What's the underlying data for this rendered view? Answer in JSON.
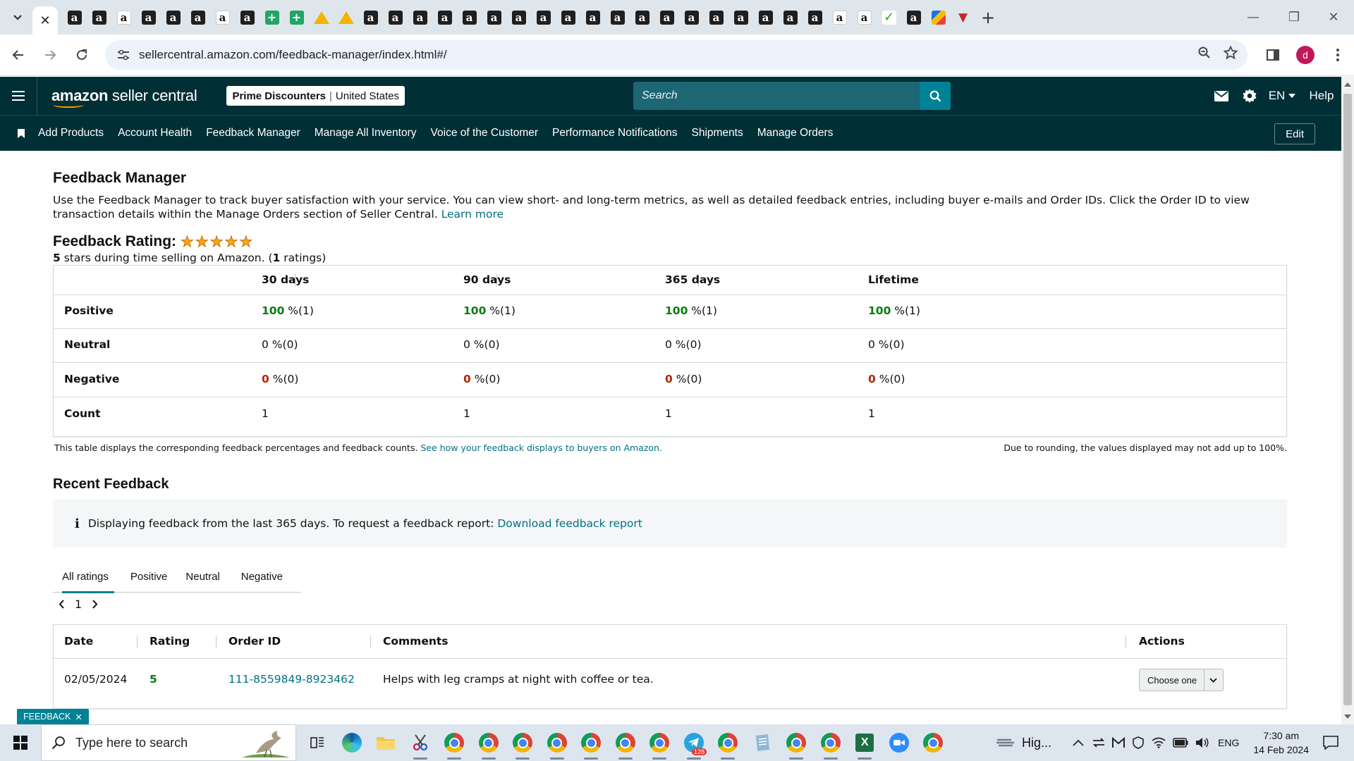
{
  "browser": {
    "url": "sellercentral.amazon.com/feedback-manager/index.html#/",
    "tab_favicons": [
      "amazon",
      "amazon",
      "amazon-white",
      "amazon",
      "amazon",
      "amazon",
      "amazon-white",
      "amazon",
      "sheets",
      "sheets",
      "drive",
      "drive",
      "amazon",
      "amazon",
      "amazon",
      "amazon",
      "amazon",
      "amazon",
      "amazon",
      "amazon",
      "amazon",
      "amazon",
      "amazon",
      "amazon",
      "amazon",
      "amazon",
      "amazon",
      "amazon",
      "amazon",
      "amazon",
      "amazon",
      "amazon-white",
      "amazon-white",
      "green-logo",
      "amazon",
      "pencil",
      "red-logo"
    ]
  },
  "header": {
    "logo_text_bold": "amazon",
    "logo_text": "seller central",
    "store_name": "Prime Discounters",
    "store_region": "United States",
    "search_placeholder": "Search",
    "language": "EN",
    "help": "Help"
  },
  "nav": {
    "links": [
      "Add Products",
      "Account Health",
      "Feedback Manager",
      "Manage All Inventory",
      "Voice of the Customer",
      "Performance Notifications",
      "Shipments",
      "Manage Orders"
    ],
    "edit_label": "Edit"
  },
  "page": {
    "title": "Feedback Manager",
    "intro": "Use the Feedback Manager to track buyer satisfaction with your service. You can view short- and long-term metrics, as well as detailed feedback entries, including buyer e-mails and Order IDs. Click the Order ID to view transaction details within the Manage Orders section of Seller Central.",
    "learn_more": "Learn more",
    "rating_label": "Feedback Rating:",
    "rating_stars": 5,
    "rating_value": "5",
    "rating_sub_mid": " stars during time selling on Amazon. (",
    "rating_count": "1",
    "rating_sub_end": " ratings)"
  },
  "metrics": {
    "columns": [
      "30 days",
      "90 days",
      "365 days",
      "Lifetime"
    ],
    "rows": [
      {
        "label": "Positive",
        "cells": [
          {
            "pct": "100",
            "rest": " %(1)"
          },
          {
            "pct": "100",
            "rest": " %(1)"
          },
          {
            "pct": "100",
            "rest": " %(1)"
          },
          {
            "pct": "100",
            "rest": " %(1)"
          }
        ]
      },
      {
        "label": "Neutral",
        "cells": [
          {
            "pct": "0",
            "rest": " %(0)"
          },
          {
            "pct": "0",
            "rest": " %(0)"
          },
          {
            "pct": "0",
            "rest": " %(0)"
          },
          {
            "pct": "0",
            "rest": " %(0)"
          }
        ]
      },
      {
        "label": "Negative",
        "cells": [
          {
            "pct": "0",
            "rest": " %(0)"
          },
          {
            "pct": "0",
            "rest": " %(0)"
          },
          {
            "pct": "0",
            "rest": " %(0)"
          },
          {
            "pct": "0",
            "rest": " %(0)"
          }
        ]
      },
      {
        "label": "Count",
        "cells": [
          {
            "pct": "1",
            "rest": ""
          },
          {
            "pct": "1",
            "rest": ""
          },
          {
            "pct": "1",
            "rest": ""
          },
          {
            "pct": "1",
            "rest": ""
          }
        ]
      }
    ],
    "note": "This table displays the corresponding feedback percentages and feedback counts.",
    "note_link": "See how your feedback displays to buyers on Amazon.",
    "rounding_note": "Due to rounding, the values displayed may not add up to 100%."
  },
  "recent": {
    "title": "Recent Feedback",
    "info_text": "Displaying feedback from the last 365 days. To request a feedback report:",
    "info_link": "Download feedback report",
    "tabs": [
      "All ratings",
      "Positive",
      "Neutral",
      "Negative"
    ],
    "page": "1",
    "table_headers": [
      "Date",
      "Rating",
      "Order ID",
      "Comments",
      "Actions"
    ],
    "rows": [
      {
        "date": "02/05/2024",
        "rating": "5",
        "order_id": "111-8559849-8923462",
        "comment": "Helps with leg cramps at night with coffee or tea.",
        "action": "Choose one"
      }
    ]
  },
  "feedback_tab": "FEEDBACK",
  "taskbar": {
    "search_placeholder": "Type here to search",
    "weather": "Hig...",
    "language": "ENG",
    "time": "7:30 am",
    "date": "14 Feb 2024",
    "telegram_badge": "128"
  },
  "colors": {
    "header_bg": "#002f36",
    "positive": "#067d0f",
    "negative": "#b12704",
    "link": "#007185",
    "accent": "#008296"
  }
}
